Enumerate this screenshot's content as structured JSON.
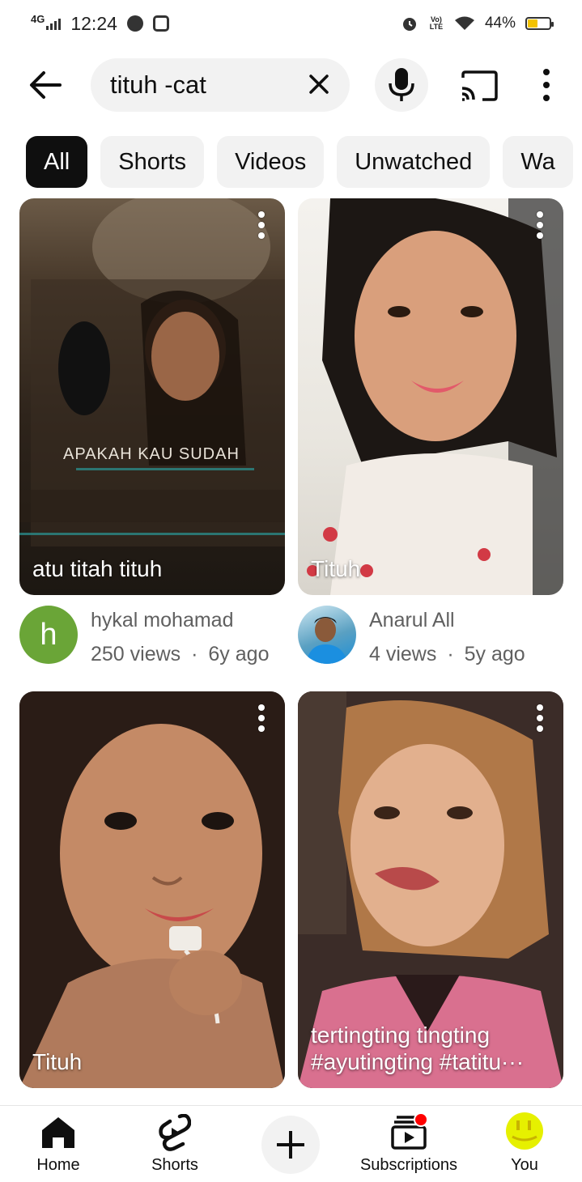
{
  "status_bar": {
    "network": "4G",
    "time": "12:24",
    "volte": "Vo) LTE",
    "battery": "44%",
    "battery_level": 0.44
  },
  "search": {
    "query": "tituh -cat",
    "icons": {
      "back": "arrow-left-icon",
      "clear": "close-icon",
      "voice": "mic-icon",
      "cast": "cast-icon",
      "more": "more-vertical-icon"
    }
  },
  "chips": [
    "All",
    "Shorts",
    "Videos",
    "Unwatched",
    "Wa"
  ],
  "videos": [
    {
      "title": "atu titah tituh",
      "overlay": "APAKAH KAU SUDAH",
      "channel": "hykal mohamad",
      "avatar_letter": "h",
      "views": "250 views",
      "age": "6y ago"
    },
    {
      "title": "Tituh",
      "channel": "Anarul All",
      "avatar_letter": "",
      "views": "4 views",
      "age": "5y ago"
    },
    {
      "title": "Tituh"
    },
    {
      "title": "tertingting tingting #ayutingting #tatitu···"
    }
  ],
  "stats_separator": "·",
  "nav": {
    "home": "Home",
    "shorts": "Shorts",
    "subscriptions": "Subscriptions",
    "you": "You"
  },
  "colors": {
    "chip_active_bg": "#0f0f0f",
    "chip_bg": "#f2f2f2",
    "avatar_h": "#6aa537",
    "notification": "#ff0000",
    "you_avatar": "#e6f000"
  }
}
